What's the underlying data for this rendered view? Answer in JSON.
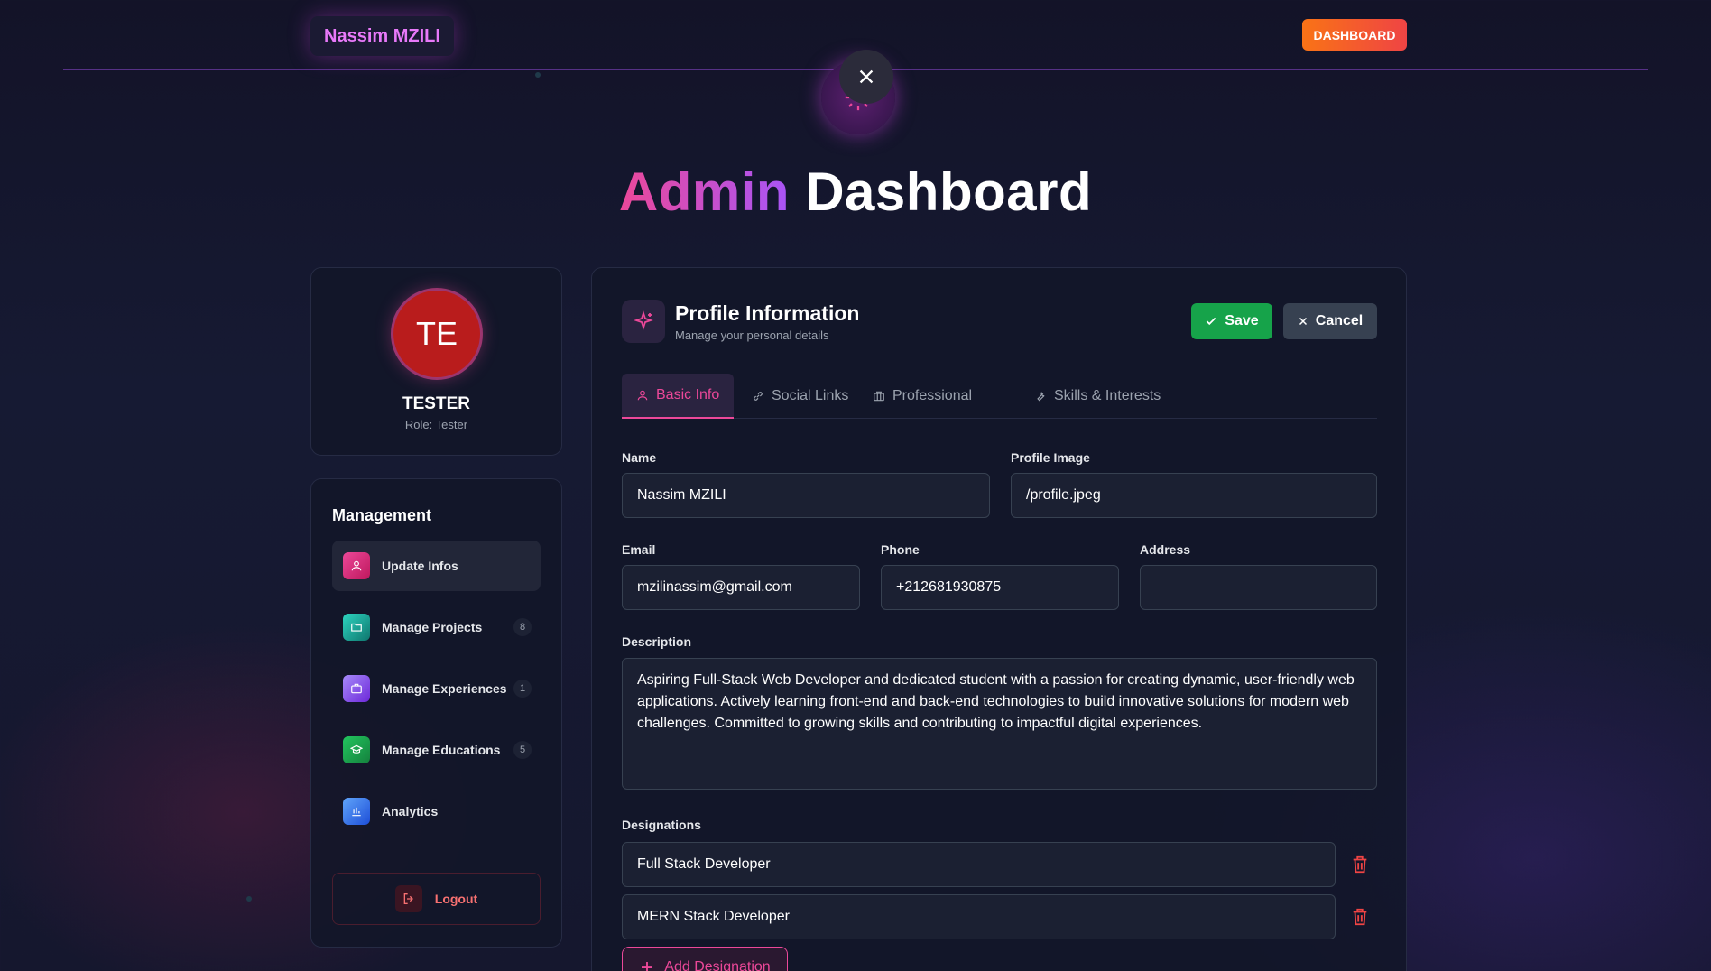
{
  "brand": "Nassim MZILI",
  "header": {
    "dashboard_label": "DASHBOARD"
  },
  "title": {
    "accent": "Admin",
    "rest": "Dashboard"
  },
  "user": {
    "initials": "TE",
    "name": "TESTER",
    "role": "Role: Tester"
  },
  "sidebar": {
    "title": "Management",
    "items": [
      {
        "label": "Update Infos",
        "icon": "user-icon",
        "count": "",
        "color": "#ec4899"
      },
      {
        "label": "Manage Projects",
        "icon": "folder-icon",
        "count": "8",
        "color": "#14b8a6"
      },
      {
        "label": "Manage Experiences",
        "icon": "briefcase-icon",
        "count": "1",
        "color": "#8b5cf6"
      },
      {
        "label": "Manage Educations",
        "icon": "graduation-cap-icon",
        "count": "5",
        "color": "#16a34a"
      },
      {
        "label": "Analytics",
        "icon": "bar-chart-icon",
        "count": "",
        "color": "#3b82f6"
      }
    ],
    "logout_label": "Logout"
  },
  "profile": {
    "title": "Profile Information",
    "subtitle": "Manage your personal details",
    "save_label": "Save",
    "cancel_label": "Cancel",
    "tabs": [
      {
        "label": "Basic Info",
        "icon": "user-icon"
      },
      {
        "label": "Social Links",
        "icon": "link-icon"
      },
      {
        "label": "Professional",
        "icon": "building-icon"
      },
      {
        "label": "Skills & Interests",
        "icon": "wrench-icon"
      }
    ],
    "fields": {
      "name_label": "Name",
      "name_value": "Nassim MZILI",
      "image_label": "Profile Image",
      "image_value": "/profile.jpeg",
      "email_label": "Email",
      "email_value": "mzilinassim@gmail.com",
      "phone_label": "Phone",
      "phone_value": "+212681930875",
      "address_label": "Address",
      "address_value": "",
      "description_label": "Description",
      "description_value": "Aspiring Full-Stack Web Developer and dedicated student with a passion for creating dynamic, user-friendly web applications. Actively learning front-end and back-end technologies to build innovative solutions for modern web challenges. Committed to growing skills and contributing to impactful digital experiences."
    },
    "designations_label": "Designations",
    "designations": [
      "Full Stack Developer",
      "MERN Stack Developer"
    ],
    "add_designation_label": "Add Designation"
  },
  "colors": {
    "accent_pink": "#ec4899",
    "accent_purple": "#a855f7",
    "save_green": "#16a34a",
    "danger": "#f87171"
  }
}
